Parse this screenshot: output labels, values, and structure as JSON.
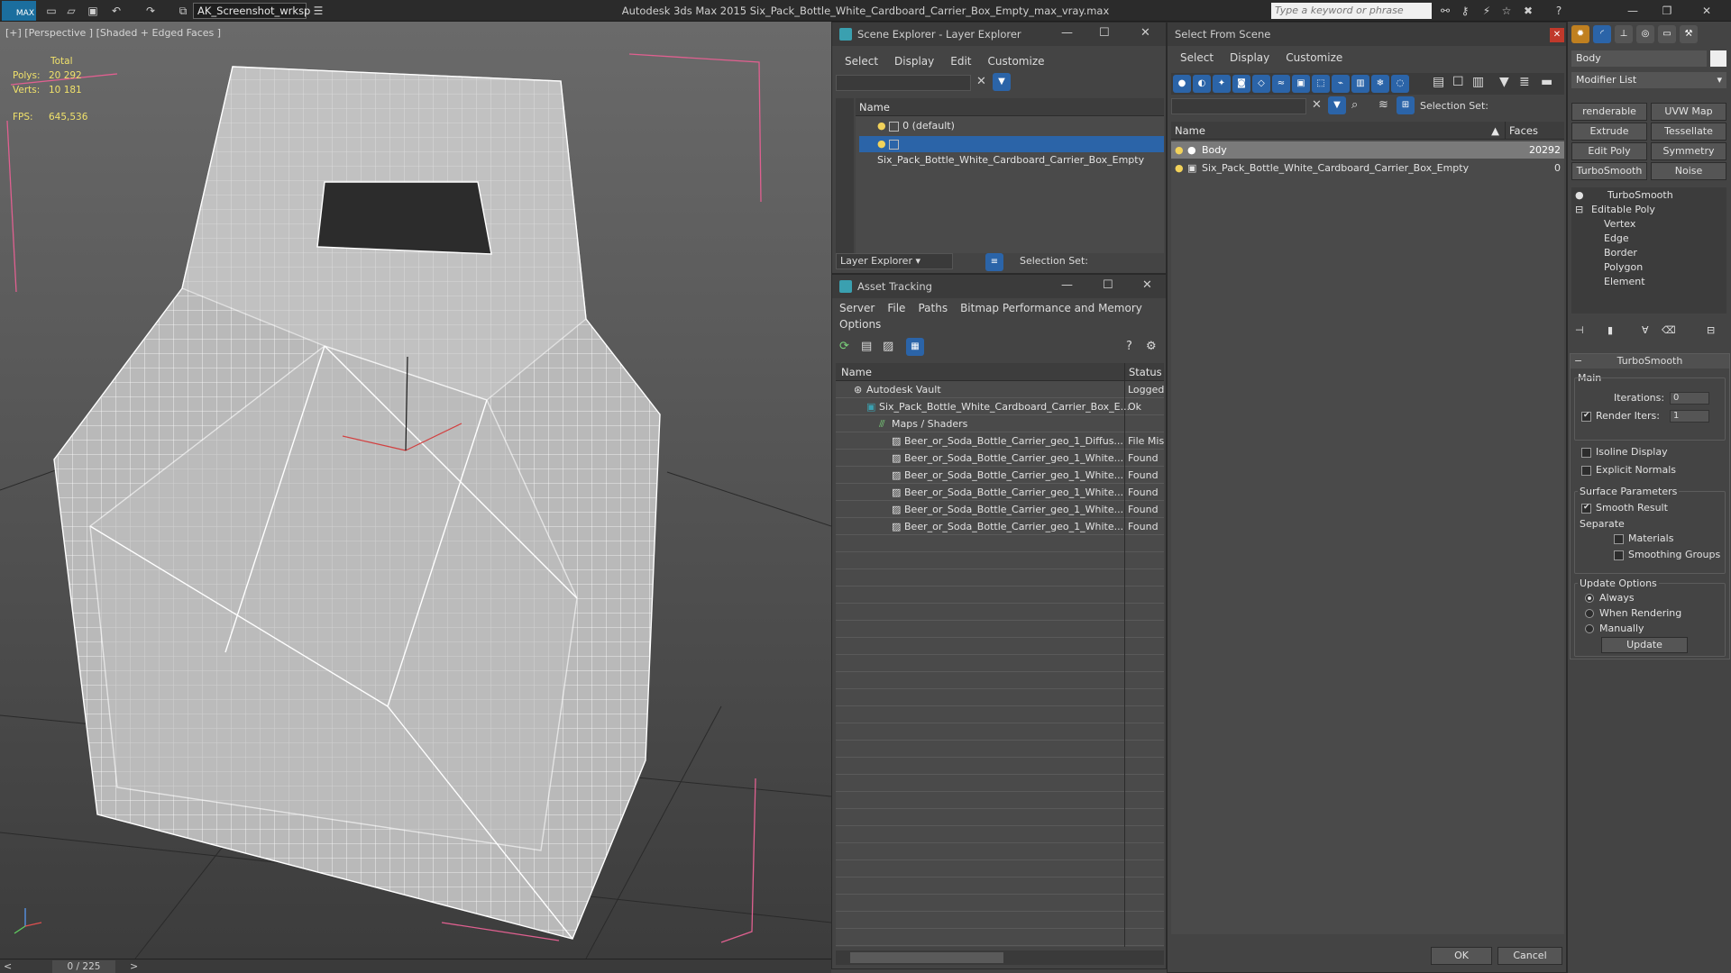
{
  "app": {
    "title": "Autodesk 3ds Max  2015    Six_Pack_Bottle_White_Cardboard_Carrier_Box_Empty_max_vray.max",
    "workspace": "AK_Screenshot_wrksp",
    "keyword_placeholder": "Type a keyword or phrase",
    "logo": "MAX"
  },
  "viewport": {
    "label": "[+] [Perspective ] [Shaded + Edged Faces ]",
    "stats": {
      "total_label": "Total",
      "polys_label": "Polys:",
      "polys_value": "20 292",
      "verts_label": "Verts:",
      "verts_value": "10 181",
      "fps_label": "FPS:",
      "fps_value": "645,536"
    }
  },
  "timeline": {
    "frame_text": "0 / 225",
    "prev": "<",
    "next": ">"
  },
  "scene_explorer": {
    "title": "Scene Explorer - Layer Explorer",
    "menu": [
      "Select",
      "Display",
      "Edit",
      "Customize"
    ],
    "column": "Name",
    "rows": [
      {
        "label": "0 (default)"
      },
      {
        "label": "Six_Pack_Bottle_White_Cardboard_Carrier_Box_Empty"
      }
    ],
    "footer_dropdown": "Layer Explorer",
    "selection_set": "Selection Set:"
  },
  "asset_tracking": {
    "title": "Asset Tracking",
    "menu": [
      "Server",
      "File",
      "Paths",
      "Bitmap Performance and Memory"
    ],
    "menu2": "Options",
    "col_name": "Name",
    "col_status": "Status",
    "rows": [
      {
        "name": "Autodesk Vault",
        "status": "Logged",
        "indent": 0
      },
      {
        "name": "Six_Pack_Bottle_White_Cardboard_Carrier_Box_E...",
        "status": "Ok",
        "indent": 1
      },
      {
        "name": "Maps / Shaders",
        "status": "",
        "indent": 2
      },
      {
        "name": "Beer_or_Soda_Bottle_Carrier_geo_1_Diffus...",
        "status": "File Mis",
        "indent": 3
      },
      {
        "name": "Beer_or_Soda_Bottle_Carrier_geo_1_White...",
        "status": "Found",
        "indent": 3
      },
      {
        "name": "Beer_or_Soda_Bottle_Carrier_geo_1_White...",
        "status": "Found",
        "indent": 3
      },
      {
        "name": "Beer_or_Soda_Bottle_Carrier_geo_1_White...",
        "status": "Found",
        "indent": 3
      },
      {
        "name": "Beer_or_Soda_Bottle_Carrier_geo_1_White...",
        "status": "Found",
        "indent": 3
      },
      {
        "name": "Beer_or_Soda_Bottle_Carrier_geo_1_White...",
        "status": "Found",
        "indent": 3
      }
    ]
  },
  "select_from_scene": {
    "title": "Select From Scene",
    "menu": [
      "Select",
      "Display",
      "Customize"
    ],
    "selection_set": "Selection Set:",
    "col_name": "Name",
    "col_faces": "Faces",
    "rows": [
      {
        "name": "Body",
        "faces": "20292"
      },
      {
        "name": "Six_Pack_Bottle_White_Cardboard_Carrier_Box_Empty",
        "faces": "0"
      }
    ],
    "ok": "OK",
    "cancel": "Cancel"
  },
  "command_panel": {
    "object_name": "Body",
    "modifier_list": "Modifier List",
    "buttons": [
      "renderable Spline",
      "UVW Map",
      "Extrude",
      "Tessellate",
      "Edit Poly",
      "Symmetry",
      "TurboSmooth",
      "Noise"
    ],
    "stack": [
      "TurboSmooth",
      "Editable Poly",
      "Vertex",
      "Edge",
      "Border",
      "Polygon",
      "Element"
    ],
    "rollout_title": "TurboSmooth",
    "main_label": "Main",
    "iterations_label": "Iterations:",
    "iterations_value": "0",
    "render_iters_label": "Render Iters:",
    "render_iters_value": "1",
    "isoline": "Isoline Display",
    "explicit": "Explicit Normals",
    "surface_params": "Surface Parameters",
    "smooth_result": "Smooth Result",
    "separate": "Separate",
    "materials": "Materials",
    "smoothing_groups": "Smoothing Groups",
    "update_options": "Update Options",
    "always": "Always",
    "when_rendering": "When Rendering",
    "manually": "Manually",
    "update": "Update"
  },
  "colors": {
    "selection_blue": "#2b64a8",
    "stats_yellow": "#f0e16b"
  }
}
